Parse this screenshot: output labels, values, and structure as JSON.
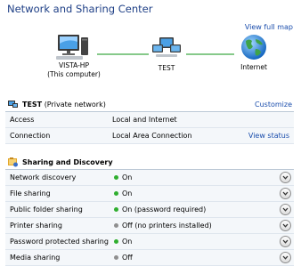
{
  "title": "Network and Sharing Center",
  "view_full_map": "View full map",
  "map": {
    "computer": {
      "name": "VISTA-HP",
      "subtitle": "(This computer)",
      "icon": "computer-icon"
    },
    "network": {
      "name": "TEST",
      "icon": "network-icon"
    },
    "internet": {
      "name": "Internet",
      "icon": "globe-icon"
    },
    "line_color": "#86c98a"
  },
  "network": {
    "name": "TEST",
    "type": "(Private network)",
    "customize": "Customize",
    "rows": [
      {
        "label": "Access",
        "value": "Local and Internet",
        "link": ""
      },
      {
        "label": "Connection",
        "value": "Local Area Connection",
        "link": "View status"
      }
    ]
  },
  "sharing": {
    "title": "Sharing and Discovery",
    "rows": [
      {
        "label": "Network discovery",
        "status": "On",
        "state": "on"
      },
      {
        "label": "File sharing",
        "status": "On",
        "state": "on"
      },
      {
        "label": "Public folder sharing",
        "status": "On (password required)",
        "state": "on"
      },
      {
        "label": "Printer sharing",
        "status": "Off (no printers installed)",
        "state": "off"
      },
      {
        "label": "Password protected sharing",
        "status": "On",
        "state": "on"
      },
      {
        "label": "Media sharing",
        "status": "Off",
        "state": "off"
      }
    ]
  },
  "colors": {
    "on": "#2fae2f",
    "off": "#8f8f8f",
    "link": "#1a4dac",
    "title": "#1e3f86"
  }
}
